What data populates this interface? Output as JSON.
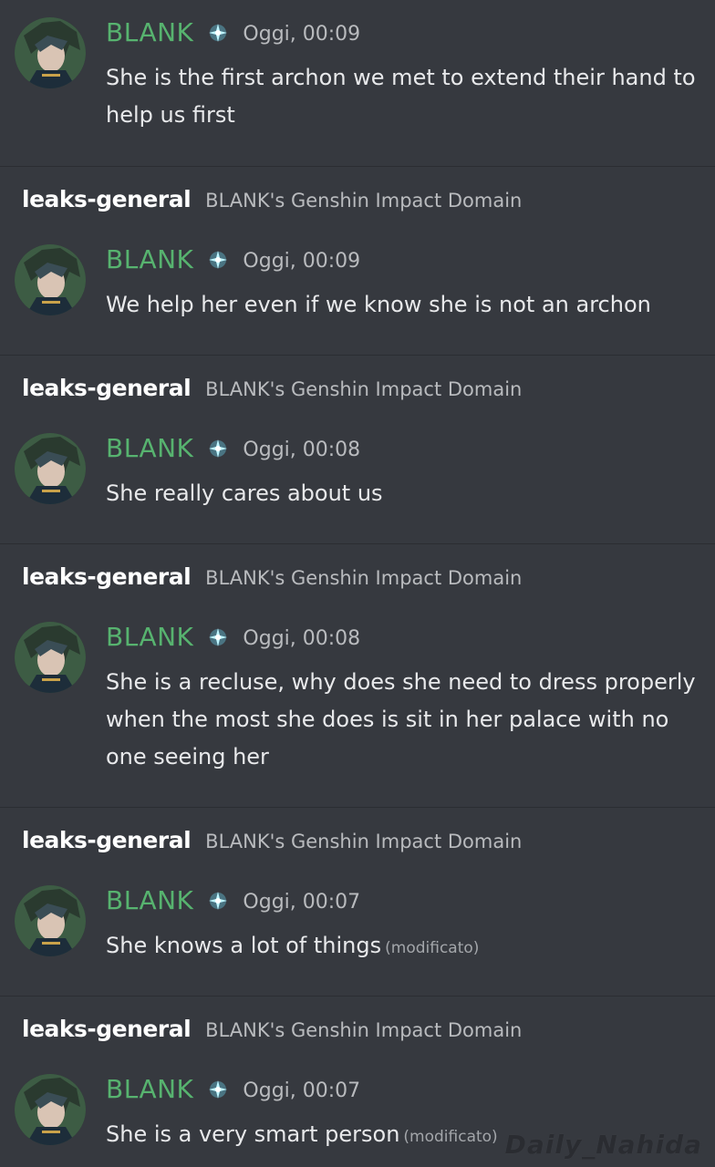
{
  "channel": {
    "name": "leaks-general",
    "server": "BLANK's Genshin Impact Domain"
  },
  "messages": [
    {
      "username": "BLANK",
      "timestamp": "Oggi, 00:09",
      "text": "She is the first archon we met to extend their hand to help us first",
      "edited": ""
    },
    {
      "username": "BLANK",
      "timestamp": "Oggi, 00:09",
      "text": "We help her even if we know she is not an archon",
      "edited": ""
    },
    {
      "username": "BLANK",
      "timestamp": "Oggi, 00:08",
      "text": "She really cares about us",
      "edited": ""
    },
    {
      "username": "BLANK",
      "timestamp": "Oggi, 00:08",
      "text": "She is a recluse, why does she need to dress properly when the most she does is sit in her palace with no one seeing her",
      "edited": ""
    },
    {
      "username": "BLANK",
      "timestamp": "Oggi, 00:07",
      "text": "She knows a lot of things",
      "edited": "(modificato)"
    },
    {
      "username": "BLANK",
      "timestamp": "Oggi, 00:07",
      "text": "She is a very smart person",
      "edited": "(modificato)"
    }
  ],
  "watermark": "Daily_Nahida",
  "colors": {
    "background": "#36393f",
    "username": "#57b36f",
    "badge": "#6fe3ff",
    "divider": "#2b2d32"
  },
  "icons": {
    "avatar": "character-avatar",
    "badge": "sparkle-badge-icon"
  }
}
